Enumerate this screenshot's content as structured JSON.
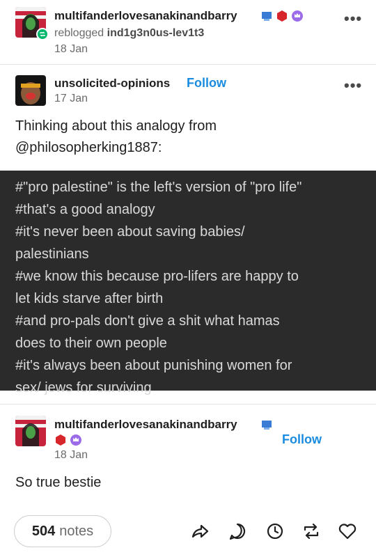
{
  "reblog_header": {
    "username": "multifanderlovesanakinandbarry",
    "reblogged_text": "reblogged",
    "source_user": "ind1g3n0us-lev1t3",
    "date": "18 Jan",
    "badge_icons": [
      "pixel-badge-icon",
      "red-hexagon-badge-icon",
      "purple-crown-badge-icon"
    ]
  },
  "original_post": {
    "username": "unsolicited-opinions",
    "follow_label": "Follow",
    "date": "17 Jan",
    "body_line1": "Thinking about this analogy from",
    "body_line2": "@philosopherking1887:",
    "tags": [
      "#\"pro palestine\" is the left's version of \"pro life\"",
      "#that's a good analogy",
      "#it's never been about saving babies/",
      "palestinians",
      "#we know this because pro-lifers are happy to",
      "let kids starve after birth",
      "#and pro-pals don't give a shit what hamas",
      "does to their own people",
      "#it's always been about punishing women for",
      "sex/ jews for surviving"
    ]
  },
  "reply_post": {
    "username": "multifanderlovesanakinandbarry",
    "follow_label": "Follow",
    "date": "18 Jan",
    "body": "So true bestie"
  },
  "footer": {
    "notes_count": "504",
    "notes_label": "notes",
    "actions": [
      "share-icon",
      "reply-icon",
      "history-icon",
      "reblog-icon",
      "like-icon"
    ]
  },
  "colors": {
    "accent_blue": "#1a8ce0",
    "reblog_green": "#00b86b",
    "tags_background": "#2b2b2b"
  }
}
